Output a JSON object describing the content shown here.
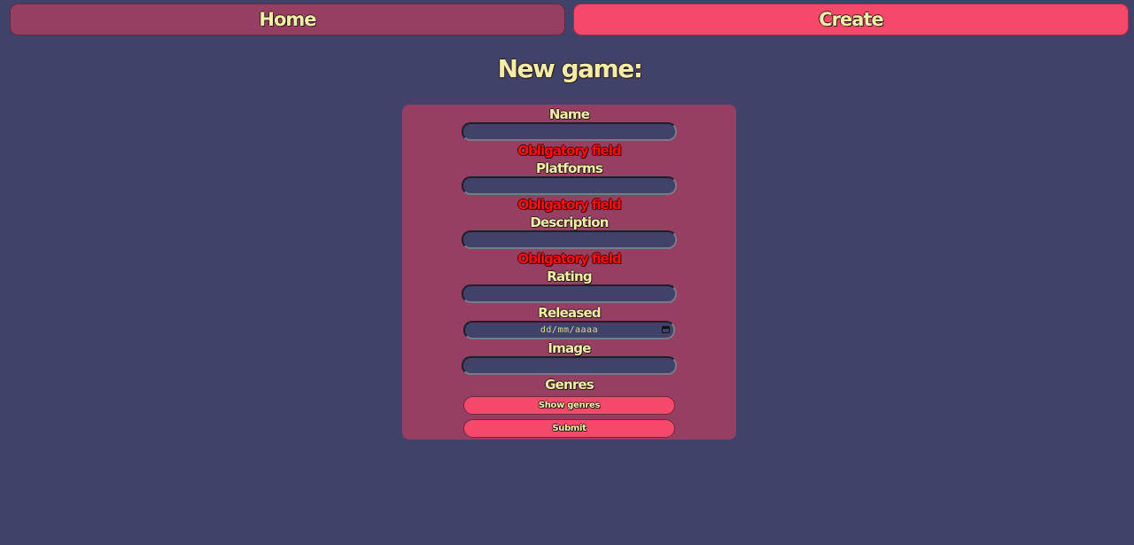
{
  "nav": {
    "home_label": "Home",
    "create_label": "Create"
  },
  "page_title": "New game:",
  "form": {
    "fields": {
      "name": {
        "label": "Name",
        "value": "",
        "error": "Obligatory field"
      },
      "platforms": {
        "label": "Platforms",
        "value": "",
        "error": "Obligatory field"
      },
      "description": {
        "label": "Description",
        "value": "",
        "error": "Obligatory field"
      },
      "rating": {
        "label": "Rating",
        "value": ""
      },
      "released": {
        "label": "Released",
        "placeholder": "dd/mm/aaaa",
        "icon": "calendar-icon"
      },
      "image": {
        "label": "Image",
        "value": ""
      },
      "genres": {
        "label": "Genres"
      }
    },
    "show_genres_label": "Show genres",
    "submit_label": "Submit"
  },
  "colors": {
    "background": "#41426a",
    "panel": "#973f62",
    "accent": "#f6486a",
    "text": "#f4eda8",
    "error": "#ff1010"
  }
}
